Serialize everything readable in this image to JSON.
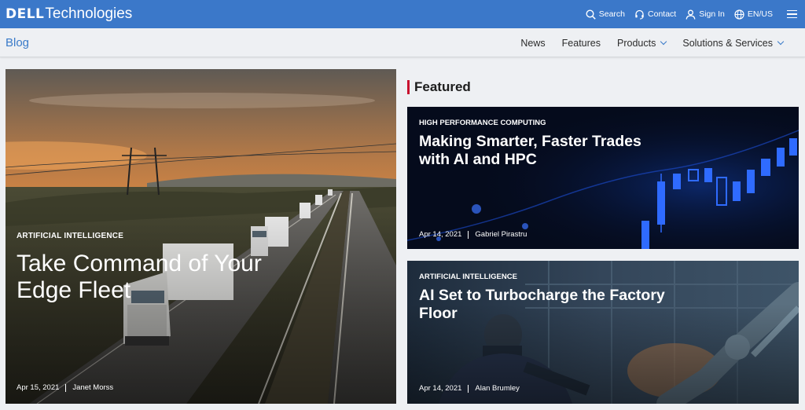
{
  "header": {
    "logo_brand": "DELL",
    "logo_suffix": "Technologies",
    "search_label": "Search",
    "contact_label": "Contact",
    "signin_label": "Sign In",
    "locale_label": "EN/US"
  },
  "subnav": {
    "blog_label": "Blog",
    "items": [
      {
        "label": "News"
      },
      {
        "label": "Features"
      },
      {
        "label": "Products"
      },
      {
        "label": "Solutions & Services"
      }
    ]
  },
  "hero": {
    "category": "ARTIFICIAL INTELLIGENCE",
    "title": "Take Command of Your Edge Fleet",
    "date": "Apr 15, 2021",
    "author": "Janet Morss"
  },
  "featured": {
    "heading": "Featured",
    "cards": [
      {
        "category": "HIGH PERFORMANCE COMPUTING",
        "title": "Making Smarter, Faster Trades with AI and HPC",
        "date": "Apr 14, 2021",
        "author": "Gabriel Pirastru"
      },
      {
        "category": "ARTIFICIAL INTELLIGENCE",
        "title": "AI Set to Turbocharge the Factory Floor",
        "date": "Apr 14, 2021",
        "author": "Alan Brumley"
      }
    ]
  },
  "colors": {
    "brand_blue": "#3b78c9",
    "link_blue": "#3a7bc9",
    "accent_red": "#c8102e"
  },
  "icons": [
    "search-icon",
    "headset-icon",
    "user-icon",
    "globe-icon",
    "menu-icon",
    "chevron-down-icon"
  ]
}
